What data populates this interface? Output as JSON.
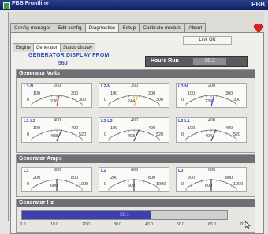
{
  "window": {
    "title": "PBB Frontline",
    "title_right": "PBB"
  },
  "main_tabs": [
    {
      "label": "Config manager",
      "active": false
    },
    {
      "label": "Edit config",
      "active": false
    },
    {
      "label": "Diagnostics",
      "active": true
    },
    {
      "label": "Setup",
      "active": false
    },
    {
      "label": "Calibrate module",
      "active": false
    },
    {
      "label": "About",
      "active": false
    }
  ],
  "status": {
    "link_label": "Link OK"
  },
  "sub_tabs": [
    {
      "label": "Engine",
      "active": false
    },
    {
      "label": "Generator",
      "active": true
    },
    {
      "label": "Status display",
      "active": false
    }
  ],
  "generator_display": {
    "title": "GENERATOR DISPLAY FROM",
    "source": "560"
  },
  "hours_run": {
    "label": "Hours Run",
    "value": "36.2"
  },
  "sections": {
    "volts": "Generator Volts",
    "amps": "Generator Amps",
    "hz": "Generator Hz"
  },
  "volts_gauges": [
    {
      "label": "L1-N",
      "min": "100",
      "mid": "200",
      "max": "300",
      "left": "0",
      "right": "300",
      "value": "236",
      "needle_color": "#e0531f",
      "fraction": 0.55
    },
    {
      "label": "L2-N",
      "min": "100",
      "mid": "200",
      "max": "300",
      "left": "0",
      "right": "300",
      "value": "244",
      "needle_color": "#f0c02c",
      "fraction": 0.58
    },
    {
      "label": "L3-N",
      "min": "100",
      "mid": "200",
      "max": "300",
      "left": "0",
      "right": "300",
      "value": "239",
      "needle_color": "#2b4fd8",
      "fraction": 0.56
    },
    {
      "label": "L1-L2",
      "min": "100",
      "mid": "400",
      "max": "400",
      "left": "0",
      "right": "520",
      "value": "408",
      "needle_color": "#555555",
      "fraction": 0.6
    },
    {
      "label": "L2-L3",
      "min": "100",
      "mid": "400",
      "max": "400",
      "left": "0",
      "right": "520",
      "value": "408",
      "needle_color": "#555555",
      "fraction": 0.6
    },
    {
      "label": "L3-L1",
      "min": "100",
      "mid": "400",
      "max": "400",
      "left": "0",
      "right": "520",
      "value": "404",
      "needle_color": "#555555",
      "fraction": 0.59
    }
  ],
  "amps_gauges": [
    {
      "label": "L1",
      "min": "200",
      "mid": "600",
      "max": "800",
      "left": "0",
      "right": "1000",
      "value": "600",
      "needle_color": "#555555",
      "fraction": 0.5
    },
    {
      "label": "L2",
      "min": "200",
      "mid": "600",
      "max": "800",
      "left": "0",
      "right": "1000",
      "value": "600",
      "needle_color": "#555555",
      "fraction": 0.5
    },
    {
      "label": "L3",
      "min": "200",
      "mid": "600",
      "max": "800",
      "left": "0",
      "right": "1000",
      "value": "600",
      "needle_color": "#555555",
      "fraction": 0.5
    }
  ],
  "hz_meter": {
    "value": "50.1",
    "fraction": 0.63,
    "ticks": [
      "0.0",
      "10.0",
      "20.0",
      "30.0",
      "40.0",
      "50.0",
      "60.0",
      "70.0"
    ]
  }
}
